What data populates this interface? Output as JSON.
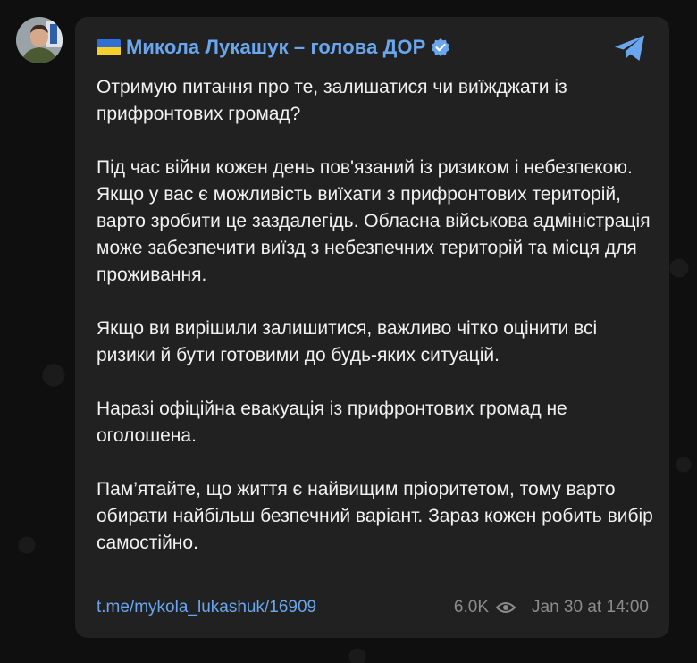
{
  "channel": {
    "name": "Микола Лукашук – голова ДОР",
    "flag": "ukraine-flag",
    "verified": true,
    "accent_color": "#6aa6ee",
    "bubble_color": "#212121"
  },
  "message": {
    "paragraphs": [
      "Отримую питання про те, залишатися чи виїжджати із прифронтових громад?",
      "Під час війни кожен день пов'язаний із ризиком і небезпекою. Якщо у вас є можливість виїхати з прифронтових територій, варто зробити це заздалегідь. Обласна військова адміністрація може забезпечити виїзд з небезпечних територій та місця для проживання.",
      "Якщо ви вирішили залишитися, важливо чітко оцінити всі ризики й бути готовими до будь-яких ситуацій.",
      "Наразі офіційна евакуація із прифронтових громад не оголошена.",
      "Пам’ятайте, що життя є найвищим пріоритетом, тому варто обирати найбільш безпечний варіант. Зараз кожен робить вибір самостійно."
    ]
  },
  "footer": {
    "link": "t.me/mykola_lukashuk/16909",
    "views": "6.0K",
    "date": "Jan 30 at 14:00"
  },
  "icons": {
    "telegram": "telegram-icon",
    "views": "eye-icon",
    "verified": "verified-badge-icon"
  }
}
